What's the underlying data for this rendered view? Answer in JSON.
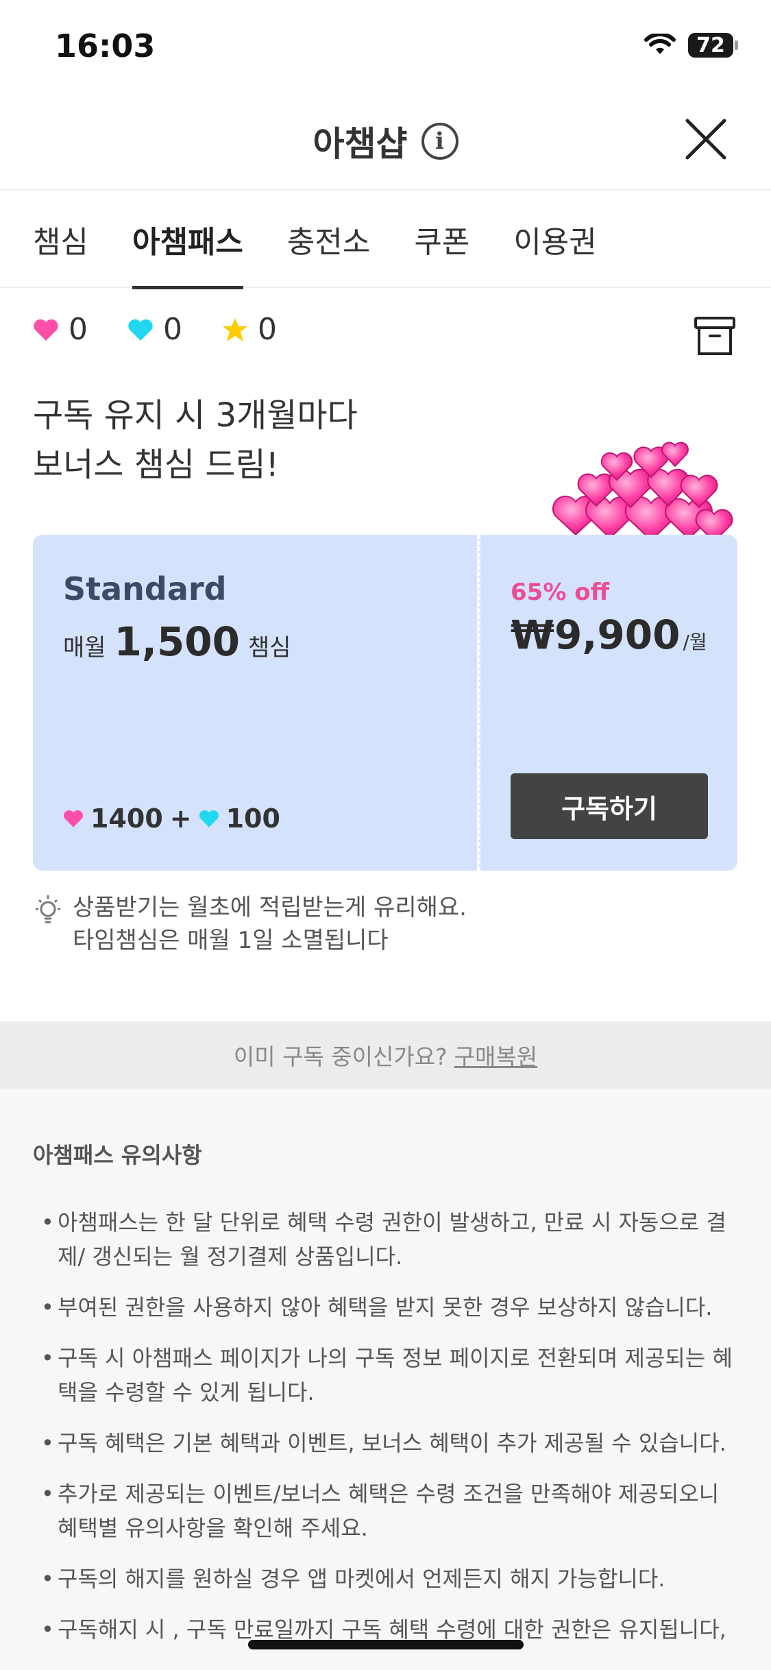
{
  "status_bar": {
    "time": "16:03",
    "battery": "72"
  },
  "header": {
    "title": "아챔샵"
  },
  "tabs": [
    {
      "label": "챔심",
      "active": false
    },
    {
      "label": "아챔패스",
      "active": true
    },
    {
      "label": "충전소",
      "active": false
    },
    {
      "label": "쿠폰",
      "active": false
    },
    {
      "label": "이용권",
      "active": false
    }
  ],
  "currencies": [
    {
      "icon": "pink-heart-icon",
      "color": "#ff4fa8",
      "value": "0"
    },
    {
      "icon": "cyan-heart-icon",
      "color": "#22d8f0",
      "value": "0"
    },
    {
      "icon": "star-icon",
      "color": "#ffcc00",
      "value": "0"
    }
  ],
  "promo": {
    "line1": "구독 유지 시 3개월마다",
    "line2": "보너스 챔심 드림!"
  },
  "plan": {
    "name": "Standard",
    "amount_prefix": "매월",
    "amount": "1,500",
    "amount_suffix": "챔심",
    "pink_count": "1400",
    "plus": "+",
    "cyan_count": "100",
    "discount": "65% off",
    "price": "₩9,900",
    "per": "/월",
    "subscribe_label": "구독하기",
    "card_color": "#d5e2fb"
  },
  "tip": {
    "line1": "상품받기는 월초에 적립받는게 유리해요.",
    "line2": "타임챔심은 매월 1일 소멸됩니다"
  },
  "restore": {
    "text": "이미 구독 중이신가요?",
    "link": "구매복원"
  },
  "notice": {
    "title": "아챔패스 유의사항",
    "items": [
      "아챔패스는 한 달 단위로 혜택 수령 권한이 발생하고, 만료 시 자동으로 결제/ 갱신되는 월 정기결제 상품입니다.",
      "부여된 권한을 사용하지 않아 혜택을 받지 못한 경우 보상하지 않습니다.",
      "구독 시 아챔패스 페이지가 나의 구독 정보 페이지로 전환되며 제공되는 혜택을 수령할 수 있게 됩니다.",
      "구독 혜택은 기본 혜택과 이벤트, 보너스 혜택이 추가 제공될 수 있습니다.",
      "추가로 제공되는 이벤트/보너스 혜택은 수령 조건을 만족해야 제공되오니 혜택별 유의사항을 확인해 주세요.",
      "구독의 해지를 원하실 경우 앱 마켓에서 언제든지 해지 가능합니다.",
      "구독해지 시 , 구독 만료일까지 구독 혜택 수령에 대한 권한은 유지됩니다,"
    ]
  }
}
